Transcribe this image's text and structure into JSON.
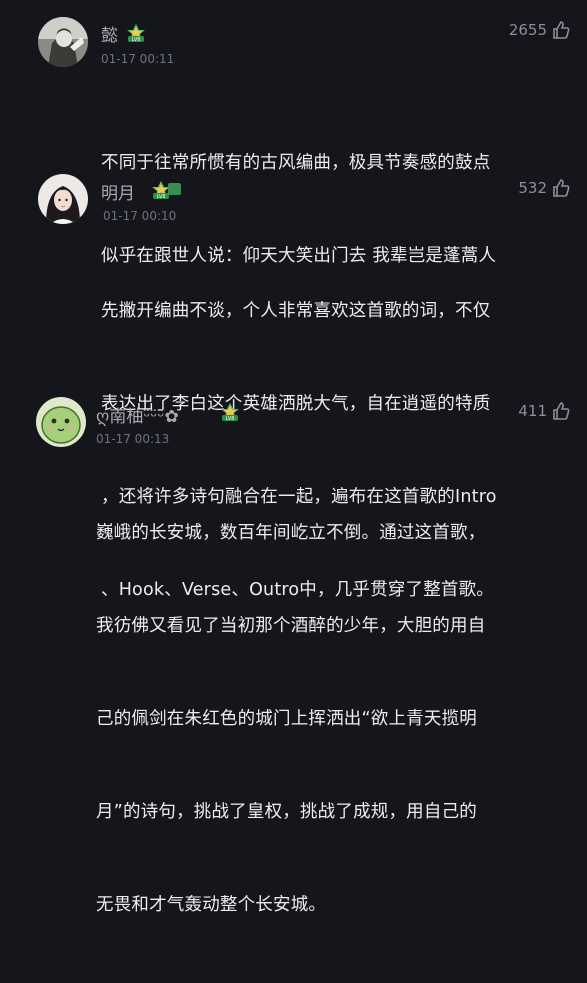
{
  "comments": [
    {
      "username": "懿",
      "time": "01-17 00:11",
      "likes": "2655",
      "level_badge": "LV8",
      "lines": [
        "不同于往常所惯有的古风编曲，极具节奏感的鼓点",
        "似乎在跟世人说：仰天大笑出门去 我辈岂是蓬蒿人"
      ]
    },
    {
      "username": "明月",
      "time": "01-17 00:10",
      "likes": "532",
      "level_badge": "LV8",
      "lines": [
        "先撇开编曲不谈，个人非常喜欢这首歌的词，不仅",
        "表达出了李白这个英雄洒脱大气，自在逍遥的特质",
        "，还将许多诗句融合在一起，遍布在这首歌的Intro",
        "、Hook、Verse、Outro中，几乎贯穿了整首歌。"
      ]
    },
    {
      "username": "ღ南柚ᵕ̈ᵕ̈ᵕ̈✿",
      "time": "01-17 00:13",
      "likes": "411",
      "level_badge": "LV8",
      "lines": [
        "巍峨的长安城，数百年间屹立不倒。通过这首歌，",
        "我彷佛又看见了当初那个酒醉的少年，大胆的用自",
        "己的佩剑在朱红色的城门上挥洒出“欲上青天揽明",
        "月”的诗句，挑战了皇权，挑战了成规，用自己的",
        "无畏和才气轰动整个长安城。"
      ]
    }
  ]
}
